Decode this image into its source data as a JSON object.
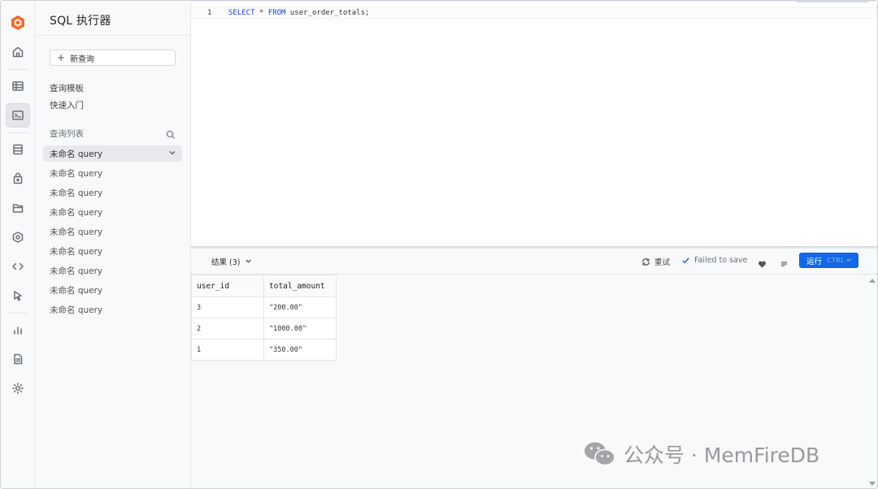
{
  "app": {
    "panel_title": "SQL 执行器"
  },
  "rail": {
    "items": [
      {
        "name": "logo-icon"
      },
      {
        "name": "home-icon"
      },
      {
        "name": "table-editor-icon"
      },
      {
        "name": "sql-editor-icon",
        "active": true
      },
      {
        "name": "database-icon"
      },
      {
        "name": "auth-icon"
      },
      {
        "name": "storage-icon"
      },
      {
        "name": "functions-icon"
      },
      {
        "name": "api-icon"
      },
      {
        "name": "logs-pointer-icon"
      },
      {
        "name": "reports-icon"
      },
      {
        "name": "docs-icon"
      },
      {
        "name": "settings-icon"
      }
    ]
  },
  "sidebar": {
    "new_query_label": "新查询",
    "links": [
      "查询模板",
      "快速入门"
    ],
    "list_header": "查询列表",
    "queries": [
      "未命名 query",
      "未命名 query",
      "未命名 query",
      "未命名 query",
      "未命名 query",
      "未命名 query",
      "未命名 query",
      "未命名 query",
      "未命名 query"
    ]
  },
  "editor": {
    "line_number": "1",
    "code_keyword_1": "SELECT",
    "code_star": " * ",
    "code_keyword_2": "FROM",
    "code_rest": " user_order_totals;"
  },
  "results": {
    "tab_label": "结果 (3)",
    "retry_label": "重试",
    "save_status": "Failed to save",
    "run_label": "运行",
    "run_shortcut": "CTRL ↵",
    "columns": [
      "user_id",
      "total_amount"
    ],
    "rows": [
      [
        "3",
        "\"200.00\""
      ],
      [
        "2",
        "\"1000.00\""
      ],
      [
        "1",
        "\"350.00\""
      ]
    ]
  },
  "watermark": {
    "text": "公众号 · MemFireDB"
  },
  "colors": {
    "accent": "#1467e6",
    "keyword": "#1a3fd8",
    "logo": "#f06b2a"
  }
}
